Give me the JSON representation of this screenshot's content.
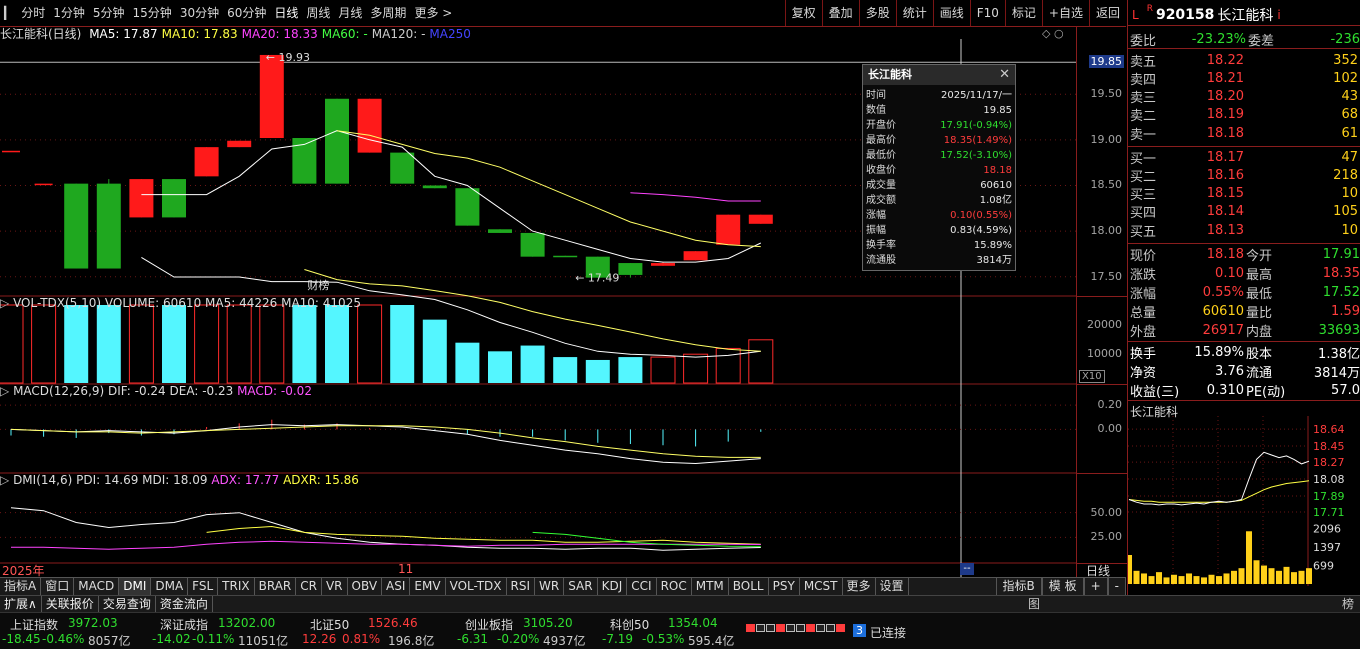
{
  "toolbar": {
    "periods": [
      "分时",
      "1分钟",
      "5分钟",
      "15分钟",
      "30分钟",
      "60分钟",
      "日线",
      "周线",
      "月线",
      "多周期",
      "更多 >"
    ],
    "right": [
      "复权",
      "叠加",
      "多股",
      "统计",
      "画线",
      "F10",
      "标记",
      "+自选",
      "返回"
    ]
  },
  "kpane": {
    "title": "长江能科(日线)",
    "ma": [
      {
        "label": "MA5: 17.87",
        "color": "#ffffff"
      },
      {
        "label": "MA10: 17.83",
        "color": "#ffff44"
      },
      {
        "label": "MA20: 18.33",
        "color": "#ff44ff"
      },
      {
        "label": "MA60: -",
        "color": "#44ff44"
      },
      {
        "label": "MA120: -",
        "color": "#cccccc"
      },
      {
        "label": "MA250",
        "color": "#4444ff"
      }
    ],
    "high_label": "19.93",
    "low_label": "17.49",
    "event_label": "财榜",
    "axis": [
      "19.85",
      "19.50",
      "19.00",
      "18.50",
      "18.00",
      "17.50"
    ],
    "current_price_tag": "19.85"
  },
  "volpane": {
    "title": "VOL-TDX(5,10)",
    "volume": "VOLUME: 60610",
    "ma5": "MA5: 44226",
    "ma10": "MA10: 41025",
    "axis": [
      "20000",
      "10000"
    ],
    "unit": "X10"
  },
  "macdpane": {
    "title": "MACD(12,26,9)",
    "dif": "DIF: -0.24",
    "dea": "DEA: -0.23",
    "macd": "MACD: -0.02",
    "axis": [
      "0.20",
      "0.00"
    ]
  },
  "dmipane": {
    "title": "DMI(14,6)",
    "pdi": "PDI: 14.69",
    "mdi": "MDI: 18.09",
    "adx": "ADX: 17.77",
    "adxr": "ADXR: 15.86",
    "axis": [
      "50.00",
      "25.00"
    ]
  },
  "xaxis": {
    "left": "2025年",
    "mid": "11",
    "right": "日线"
  },
  "chart_data": {
    "type": "candlestick",
    "ylim": [
      17.3,
      20.05
    ],
    "candles": [
      {
        "o": 18.88,
        "c": 18.88,
        "h": 18.88,
        "l": 18.88
      },
      {
        "o": 18.52,
        "c": 18.52,
        "h": 18.52,
        "l": 18.52
      },
      {
        "o": 18.52,
        "c": 17.59,
        "h": 18.52,
        "l": 17.59
      },
      {
        "o": 18.52,
        "c": 17.59,
        "h": 18.57,
        "l": 17.59
      },
      {
        "o": 18.15,
        "c": 18.57,
        "h": 18.57,
        "l": 18.15
      },
      {
        "o": 18.57,
        "c": 18.15,
        "h": 18.57,
        "l": 18.15
      },
      {
        "o": 18.6,
        "c": 18.92,
        "h": 18.92,
        "l": 18.6
      },
      {
        "o": 18.92,
        "c": 18.99,
        "h": 18.99,
        "l": 18.92
      },
      {
        "o": 19.02,
        "c": 19.93,
        "h": 19.93,
        "l": 19.02
      },
      {
        "o": 19.02,
        "c": 18.52,
        "h": 19.02,
        "l": 18.52
      },
      {
        "o": 19.45,
        "c": 18.52,
        "h": 19.45,
        "l": 18.52
      },
      {
        "o": 18.86,
        "c": 19.45,
        "h": 19.45,
        "l": 18.86
      },
      {
        "o": 18.86,
        "c": 18.52,
        "h": 18.86,
        "l": 18.52
      },
      {
        "o": 18.5,
        "c": 18.47,
        "h": 18.5,
        "l": 18.47
      },
      {
        "o": 18.47,
        "c": 18.06,
        "h": 18.47,
        "l": 18.06
      },
      {
        "o": 18.02,
        "c": 17.98,
        "h": 18.02,
        "l": 17.98
      },
      {
        "o": 17.98,
        "c": 17.72,
        "h": 17.98,
        "l": 17.72
      },
      {
        "o": 17.73,
        "c": 17.72,
        "h": 17.73,
        "l": 17.72
      },
      {
        "o": 17.72,
        "c": 17.49,
        "h": 17.72,
        "l": 17.49
      },
      {
        "o": 17.65,
        "c": 17.52,
        "h": 17.65,
        "l": 17.49
      },
      {
        "o": 17.62,
        "c": 17.65,
        "h": 17.66,
        "l": 17.62
      },
      {
        "o": 17.68,
        "c": 17.78,
        "h": 17.78,
        "l": 17.68
      },
      {
        "o": 17.85,
        "c": 18.18,
        "h": 18.18,
        "l": 17.85
      },
      {
        "o": 18.08,
        "c": 18.18,
        "h": 18.18,
        "l": 18.08
      }
    ],
    "ma5": [
      null,
      null,
      null,
      null,
      18.4,
      18.4,
      18.4,
      18.6,
      18.9,
      18.95,
      19.1,
      19.0,
      18.92,
      18.6,
      18.5,
      18.25,
      18.0,
      17.9,
      17.8,
      17.7,
      17.66,
      17.66,
      17.7,
      17.87
    ],
    "ma10": [
      null,
      null,
      null,
      null,
      null,
      null,
      null,
      null,
      null,
      null,
      19.1,
      19.05,
      18.95,
      18.85,
      18.8,
      18.7,
      18.55,
      18.4,
      18.25,
      18.1,
      18.0,
      17.9,
      17.85,
      17.83
    ],
    "ma20": [
      null,
      null,
      null,
      null,
      null,
      null,
      null,
      null,
      null,
      null,
      null,
      null,
      null,
      null,
      null,
      null,
      null,
      null,
      null,
      18.42,
      18.4,
      18.37,
      18.33,
      18.33
    ],
    "volumes": [
      68000,
      45000,
      35000,
      38000,
      32000,
      34000,
      45000,
      35000,
      30000,
      32000,
      33000,
      30000,
      28000,
      22000,
      14000,
      11000,
      13000,
      9000,
      8000,
      9000,
      9000,
      10000,
      12000,
      15000
    ],
    "vol_ylim": [
      0,
      25000
    ],
    "macd": [
      -0.05,
      -0.06,
      -0.07,
      -0.03,
      -0.05,
      -0.04,
      0.02,
      0.05,
      0.08,
      0.04,
      0.05,
      0.01,
      0.0,
      -0.01,
      -0.04,
      -0.06,
      -0.06,
      -0.09,
      -0.11,
      -0.12,
      -0.13,
      -0.14,
      -0.1,
      -0.02
    ],
    "dif": [
      0.0,
      -0.01,
      -0.02,
      -0.01,
      -0.02,
      -0.03,
      -0.01,
      0.02,
      0.04,
      0.03,
      0.04,
      0.03,
      0.02,
      -0.01,
      -0.04,
      -0.09,
      -0.13,
      -0.17,
      -0.2,
      -0.24,
      -0.27,
      -0.28,
      -0.26,
      -0.24
    ],
    "dea": [
      0.0,
      -0.01,
      -0.02,
      -0.02,
      -0.03,
      -0.02,
      -0.01,
      0.0,
      0.01,
      0.02,
      0.03,
      0.03,
      0.03,
      0.02,
      0.0,
      -0.03,
      -0.07,
      -0.1,
      -0.14,
      -0.17,
      -0.2,
      -0.22,
      -0.23,
      -0.23
    ],
    "macd_ylim": [
      -0.35,
      0.25
    ],
    "pdi": [
      55,
      52,
      40,
      35,
      38,
      40,
      48,
      50,
      40,
      30,
      24,
      20,
      18,
      17,
      15,
      14,
      14,
      13,
      14,
      14,
      12,
      13,
      14,
      14.69
    ],
    "mdi": [
      null,
      null,
      null,
      null,
      null,
      null,
      30,
      34,
      36,
      30,
      28,
      27,
      26,
      24,
      23,
      22,
      22,
      20,
      20,
      21,
      22,
      20,
      19,
      18.09
    ],
    "adx": [
      15,
      15,
      14,
      13,
      14,
      15,
      18,
      20,
      21,
      20,
      19,
      18,
      18,
      17,
      16,
      17,
      17,
      18,
      18,
      18,
      18,
      18,
      18,
      17.77
    ],
    "adxr": [
      null,
      null,
      null,
      null,
      null,
      null,
      null,
      null,
      null,
      null,
      null,
      null,
      null,
      null,
      null,
      null,
      30,
      28,
      24,
      20,
      18,
      17,
      16,
      15.86
    ],
    "dmi_ylim": [
      0,
      75
    ]
  },
  "popup": {
    "title": "长江能科",
    "rows": [
      {
        "k": "时间",
        "v": "2025/11/17/一",
        "c": "white"
      },
      {
        "k": "数值",
        "v": "19.85",
        "c": "white"
      },
      {
        "k": "开盘价",
        "v": "17.91(-0.94%)",
        "c": "green"
      },
      {
        "k": "最高价",
        "v": "18.35(1.49%)",
        "c": "red"
      },
      {
        "k": "最低价",
        "v": "17.52(-3.10%)",
        "c": "green"
      },
      {
        "k": "收盘价",
        "v": "18.18",
        "c": "red"
      },
      {
        "k": "成交量",
        "v": "60610",
        "c": "white"
      },
      {
        "k": "成交额",
        "v": "1.08亿",
        "c": "white"
      },
      {
        "k": "涨幅",
        "v": "0.10(0.55%)",
        "c": "red"
      },
      {
        "k": "振幅",
        "v": "0.83(4.59%)",
        "c": "white"
      },
      {
        "k": "换手率",
        "v": "15.89%",
        "c": "white"
      },
      {
        "k": "流通股",
        "v": "3814万",
        "c": "white"
      }
    ]
  },
  "right": {
    "flag": "L",
    "flag2": "R",
    "code": "920158",
    "name": "长江能科",
    "weibi_label": "委比",
    "weibi": "-23.23%",
    "weicha_label": "委差",
    "weicha": "-236",
    "sells": [
      {
        "k": "卖五",
        "p": "18.22",
        "v": "352"
      },
      {
        "k": "卖四",
        "p": "18.21",
        "v": "102"
      },
      {
        "k": "卖三",
        "p": "18.20",
        "v": "43"
      },
      {
        "k": "卖二",
        "p": "18.19",
        "v": "68"
      },
      {
        "k": "卖一",
        "p": "18.18",
        "v": "61"
      }
    ],
    "buys": [
      {
        "k": "买一",
        "p": "18.17",
        "v": "47"
      },
      {
        "k": "买二",
        "p": "18.16",
        "v": "218"
      },
      {
        "k": "买三",
        "p": "18.15",
        "v": "10"
      },
      {
        "k": "买四",
        "p": "18.14",
        "v": "105"
      },
      {
        "k": "买五",
        "p": "18.13",
        "v": "10"
      }
    ],
    "stats": [
      {
        "k1": "现价",
        "v1": "18.18",
        "c1": "red",
        "k2": "今开",
        "v2": "17.91",
        "c2": "green"
      },
      {
        "k1": "涨跌",
        "v1": "0.10",
        "c1": "red",
        "k2": "最高",
        "v2": "18.35",
        "c2": "red"
      },
      {
        "k1": "涨幅",
        "v1": "0.55%",
        "c1": "red",
        "k2": "最低",
        "v2": "17.52",
        "c2": "green"
      },
      {
        "k1": "总量",
        "v1": "60610",
        "c1": "yellow",
        "k2": "量比",
        "v2": "1.59",
        "c2": "red"
      },
      {
        "k1": "外盘",
        "v1": "26917",
        "c1": "red",
        "k2": "内盘",
        "v2": "33693",
        "c2": "green"
      }
    ],
    "stats2": [
      {
        "k1": "换手",
        "v1": "15.89%",
        "k2": "股本",
        "v2": "1.38亿"
      },
      {
        "k1": "净资",
        "v1": "3.76",
        "k2": "流通",
        "v2": "3814万"
      },
      {
        "k1": "收益(三)",
        "v1": "0.310",
        "k2": "PE(动)",
        "v2": "57.0"
      }
    ],
    "mini_title": "长江能科",
    "mini_axis": [
      "18.64",
      "18.45",
      "18.27",
      "18.08",
      "17.89",
      "17.71"
    ],
    "mini_vol_axis": [
      "2096",
      "1397",
      "699"
    ],
    "mini_price": [
      17.85,
      17.82,
      17.8,
      17.8,
      17.79,
      17.8,
      17.8,
      17.79,
      17.8,
      17.81,
      17.8,
      17.82,
      17.83,
      17.82,
      17.83,
      17.85,
      18.08,
      18.3,
      18.38,
      18.35,
      18.32,
      18.34,
      18.3,
      18.25,
      18.28
    ],
    "mini_avg": [
      17.85,
      17.84,
      17.83,
      17.83,
      17.82,
      17.82,
      17.82,
      17.82,
      17.82,
      17.82,
      17.82,
      17.82,
      17.82,
      17.82,
      17.83,
      17.84,
      17.88,
      17.92,
      17.96,
      17.99,
      18.01,
      18.03,
      18.04,
      18.05,
      18.06
    ],
    "mini_vol": [
      1100,
      500,
      400,
      300,
      450,
      250,
      350,
      300,
      400,
      300,
      250,
      350,
      300,
      400,
      500,
      600,
      2000,
      900,
      700,
      600,
      500,
      650,
      450,
      500,
      600
    ]
  },
  "bottom_tabs": [
    "指标A",
    "窗口",
    "MACD",
    "DMI",
    "DMA",
    "FSL",
    "TRIX",
    "BRAR",
    "CR",
    "VR",
    "OBV",
    "ASI",
    "EMV",
    "VOL-TDX",
    "RSI",
    "WR",
    "SAR",
    "KDJ",
    "CCI",
    "ROC",
    "MTM",
    "BOLL",
    "PSY",
    "MCST",
    "更多",
    "设置"
  ],
  "bottom_right_tabs": [
    "指标B",
    "模 板",
    "+",
    "-"
  ],
  "tab_row2": [
    "扩展∧",
    "关联报价",
    "交易查询",
    "资金流向"
  ],
  "tab_row2_right": "图",
  "tab_row2_far": "榜",
  "indices": [
    {
      "name": "上证指数",
      "value": "3972.03",
      "chg": "-18.45",
      "pct": "-0.46%",
      "amt": "8057亿",
      "col": "green"
    },
    {
      "name": "深证成指",
      "value": "13202.00",
      "chg": "-14.02",
      "pct": "-0.11%",
      "amt": "11051亿",
      "col": "green"
    },
    {
      "name": "北证50",
      "value": "1526.46",
      "chg": "12.26",
      "pct": "0.81%",
      "amt": "196.8亿",
      "col": "red"
    },
    {
      "name": "创业板指",
      "value": "3105.20",
      "chg": "-6.31",
      "pct": "-0.20%",
      "amt": "4937亿",
      "col": "green"
    },
    {
      "name": "科创50",
      "value": "1354.04",
      "chg": "-7.19",
      "pct": "-0.53%",
      "amt": "595.4亿",
      "col": "green"
    }
  ],
  "conn": {
    "count": "3",
    "label": "已连接"
  }
}
